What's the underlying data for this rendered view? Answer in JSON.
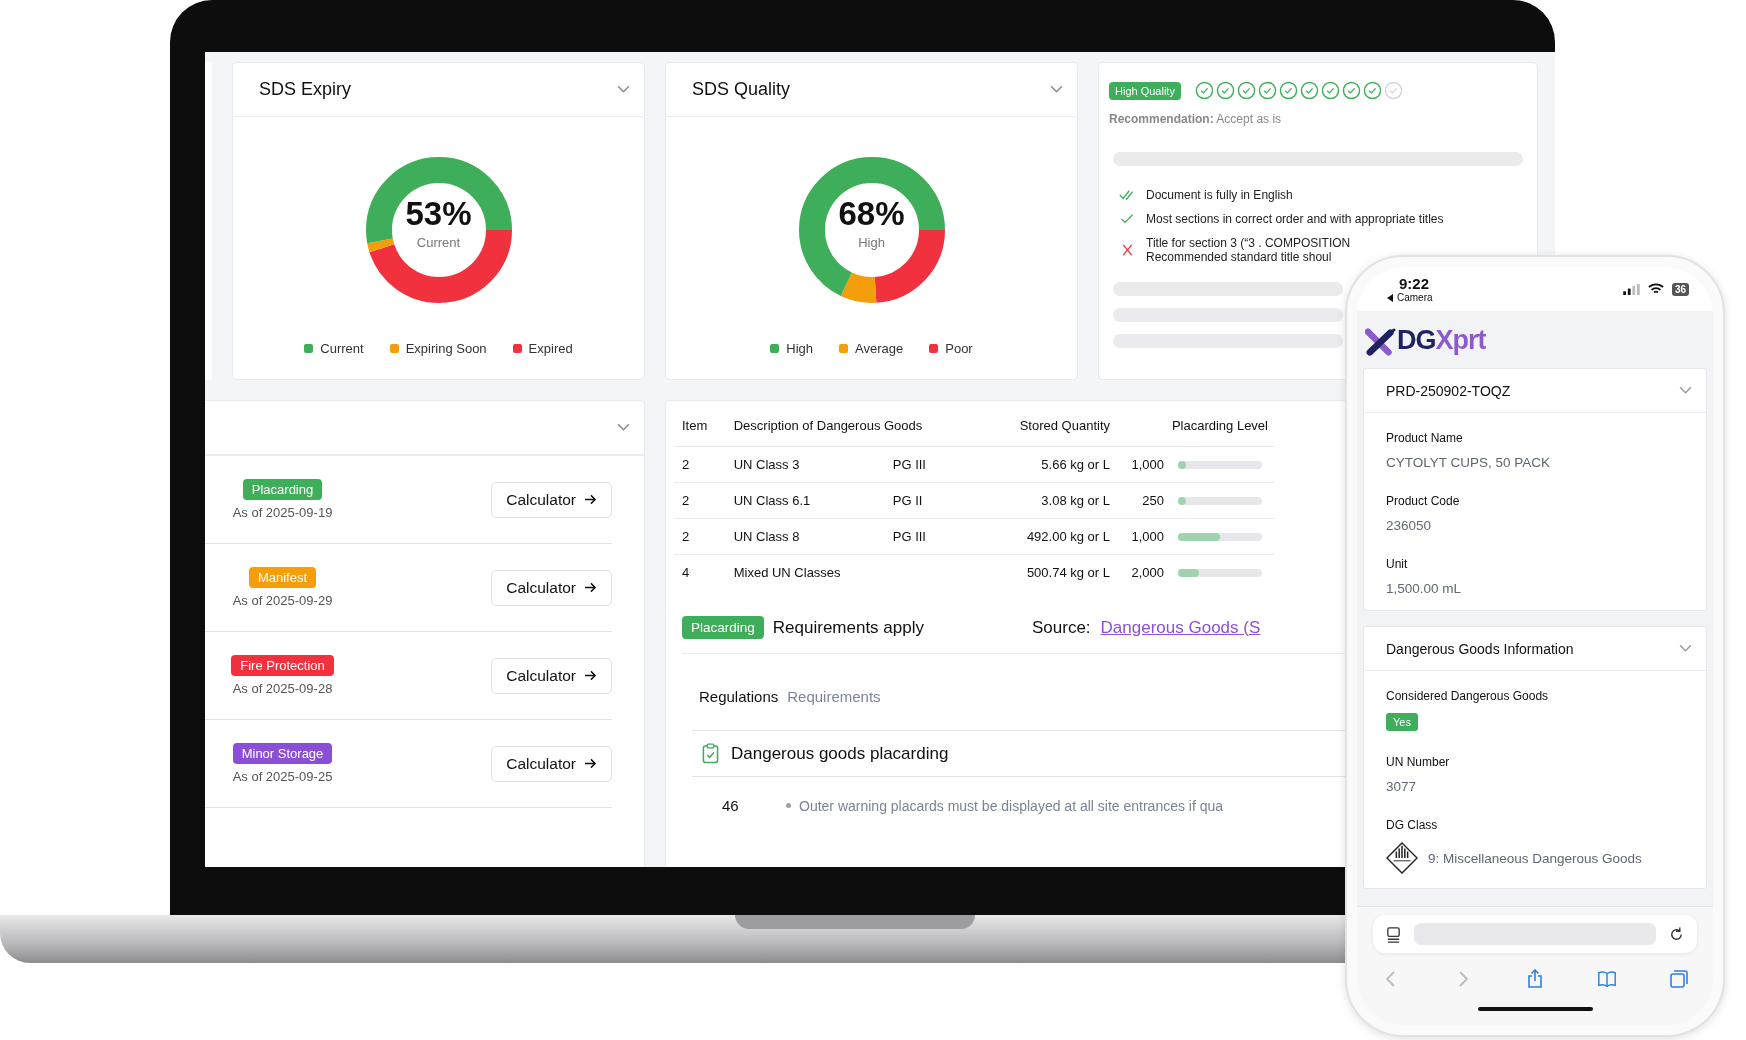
{
  "laptop": {
    "donut_cards": [
      {
        "title": "SDS Expiry",
        "value": "53%",
        "caption": "Current",
        "legend": [
          {
            "label": "Current",
            "color": "#3fae5a"
          },
          {
            "label": "Expiring Soon",
            "color": "#f59e0b"
          },
          {
            "label": "Expired",
            "color": "#f2313f"
          }
        ]
      },
      {
        "title": "SDS Quality",
        "value": "68%",
        "caption": "High",
        "legend": [
          {
            "label": "High",
            "color": "#3fae5a"
          },
          {
            "label": "Average",
            "color": "#f59e0b"
          },
          {
            "label": "Poor",
            "color": "#f2313f"
          }
        ]
      }
    ],
    "quality_panel": {
      "badge": "High Quality",
      "checks": [
        {
          "checked": true
        },
        {
          "checked": true
        },
        {
          "checked": true
        },
        {
          "checked": true
        },
        {
          "checked": true
        },
        {
          "checked": true
        },
        {
          "checked": true
        },
        {
          "checked": true
        },
        {
          "checked": true
        },
        {
          "checked": false
        }
      ],
      "recommendation": "**Recommendation:** Accept as is",
      "findings": [
        {
          "kind": "pass_all",
          "text": "Document is fully in English"
        },
        {
          "kind": "pass",
          "text": "Most sections in correct order and with appropriate titles"
        },
        {
          "kind": "fail",
          "text": "Title for section 3 (“3 . COMPOSITION",
          "note": "Recommended standard title shoul"
        }
      ]
    },
    "calculators": [
      {
        "tag": "Placarding",
        "color": "#3fae5a",
        "date": "As of 2025-09-19",
        "button": "Calculator"
      },
      {
        "tag": "Manifest",
        "color": "#f59e0b",
        "date": "As of 2025-09-29",
        "button": "Calculator"
      },
      {
        "tag": "Fire Protection",
        "color": "#f2313f",
        "date": "As of 2025-09-28",
        "button": "Calculator"
      },
      {
        "tag": "Minor Storage",
        "color": "#8b4fd6",
        "date": "As of 2025-09-25",
        "button": "Calculator"
      }
    ],
    "table": {
      "columns": [
        "Item",
        "Description of Dangerous Goods",
        "Stored Quantity",
        "Placarding Level"
      ],
      "rows": [
        {
          "item": "2",
          "description": "UN Class 3",
          "group": "PG III",
          "quantity": "5.66 kg or L",
          "threshold": "1,000",
          "level": 0.08
        },
        {
          "item": "2",
          "description": "UN Class 6.1",
          "group": "PG II",
          "quantity": "3.08 kg or L",
          "threshold": "250",
          "level": 0.08
        },
        {
          "item": "2",
          "description": "UN Class 8",
          "group": "PG III",
          "quantity": "492.00 kg or L",
          "threshold": "1,000",
          "level": 0.5
        },
        {
          "item": "4",
          "description": "Mixed UN Classes",
          "quantity": "500.74 kg or L",
          "threshold": "2,000",
          "level": 0.25
        }
      ]
    },
    "requirement": {
      "badge": "Placarding",
      "text": "Requirements apply",
      "source_label": "Source:",
      "source_link": "Dangerous Goods (S"
    },
    "tabs": [
      {
        "label": "Regulations",
        "selected": true
      },
      {
        "label": "Requirements",
        "selected": false
      }
    ],
    "section": {
      "title": "Dangerous goods placarding",
      "lines": [
        {
          "number": "46",
          "text": "Outer warning placards must be displayed at all site entrances if qua"
        }
      ]
    }
  },
  "phone": {
    "time": "9:22",
    "back_app": "Camera",
    "battery": "36",
    "logo": "DGXprt",
    "product_card": {
      "title": "PRD-250902-TOQZ",
      "fields": [
        {
          "label": "Product Name",
          "value": "CYTOLYT CUPS, 50 PACK"
        },
        {
          "label": "Product Code",
          "value": "236050"
        },
        {
          "label": "Unit",
          "value": "1,500.00 mL"
        }
      ]
    },
    "dg_card": {
      "title": "Dangerous Goods Information",
      "considered_label": "Considered Dangerous Goods",
      "considered_badge": "Yes",
      "fields": [
        {
          "label": "UN Number",
          "value": "3077"
        }
      ],
      "class_label": "DG Class",
      "class_value": "9: Miscellaneous Dangerous Goods"
    }
  }
}
